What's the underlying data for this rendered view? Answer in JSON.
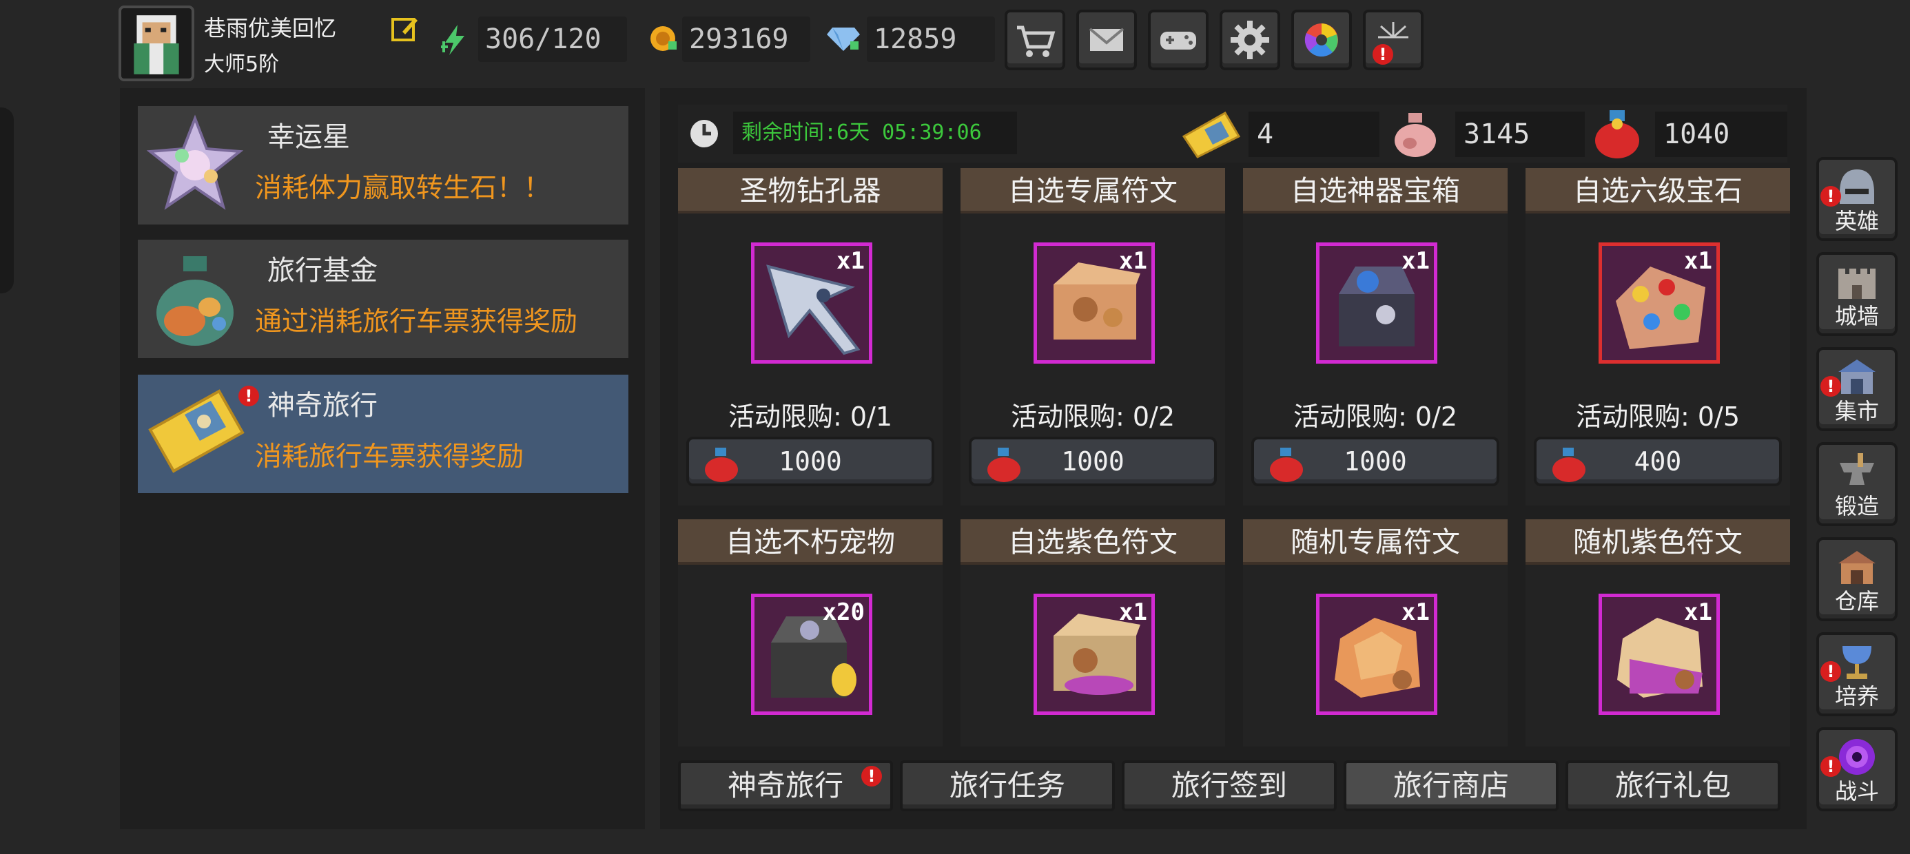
{
  "player": {
    "name": "巷雨优美回忆",
    "rank": "大师5阶"
  },
  "resources": {
    "stamina": "306/120",
    "gold": "293169",
    "diamonds": "12859"
  },
  "top_buttons": [
    "cart-icon",
    "mail-icon",
    "gamepad-icon",
    "gear-icon",
    "color-wheel-icon",
    "fireworks-icon"
  ],
  "menu": [
    {
      "title": "幸运星",
      "desc": "消耗体力赢取转生石！！",
      "icon": "lucky-star-icon"
    },
    {
      "title": "旅行基金",
      "desc": "通过消耗旅行车票获得奖励",
      "icon": "money-bag-icon"
    },
    {
      "title": "神奇旅行",
      "desc": "消耗旅行车票获得奖励",
      "icon": "ticket-icon"
    }
  ],
  "event": {
    "remaining_time": "剩余时间:6天 05:39:06",
    "tickets": "4",
    "pouch_a": "3145",
    "pouch_b": "1040"
  },
  "shop_items": [
    {
      "name": "圣物钻孔器",
      "qty": "x1",
      "limit": "活动限购:  0/1",
      "price": "1000",
      "icon": "drill-icon"
    },
    {
      "name": "自选专属符文",
      "qty": "x1",
      "limit": "活动限购:  0/2",
      "price": "1000",
      "icon": "rune-chest-icon"
    },
    {
      "name": "自选神器宝箱",
      "qty": "x1",
      "limit": "活动限购:  0/2",
      "price": "1000",
      "icon": "artifact-chest-icon"
    },
    {
      "name": "自选六级宝石",
      "qty": "x1",
      "limit": "活动限购:  0/5",
      "price": "400",
      "icon": "gem-bag-icon"
    },
    {
      "name": "自选不朽宠物",
      "qty": "x20",
      "icon": "pet-chest-icon"
    },
    {
      "name": "自选紫色符文",
      "qty": "x1",
      "icon": "purple-rune-chest-icon"
    },
    {
      "name": "随机专属符文",
      "qty": "x1",
      "icon": "random-rune-icon"
    },
    {
      "name": "随机紫色符文",
      "qty": "x1",
      "icon": "random-purple-rune-icon"
    }
  ],
  "tabs": [
    "神奇旅行",
    "旅行任务",
    "旅行签到",
    "旅行商店",
    "旅行礼包"
  ],
  "active_tab": "旅行商店",
  "sidebar": [
    {
      "label": "英雄",
      "icon": "helmet-icon",
      "alert": true
    },
    {
      "label": "城墙",
      "icon": "wall-icon",
      "alert": false
    },
    {
      "label": "集市",
      "icon": "market-icon",
      "alert": true
    },
    {
      "label": "锻造",
      "icon": "anvil-icon",
      "alert": false
    },
    {
      "label": "仓库",
      "icon": "warehouse-icon",
      "alert": false
    },
    {
      "label": "培养",
      "icon": "chalice-icon",
      "alert": true
    },
    {
      "label": "战斗",
      "icon": "portal-icon",
      "alert": true
    }
  ],
  "alert_mark": "!",
  "colors": {
    "accent_orange": "#f0961e",
    "timer_green": "#3cc83c",
    "active_menu": "#435975",
    "item_border": "#d22ad2",
    "alert_red": "#d81e1e"
  }
}
